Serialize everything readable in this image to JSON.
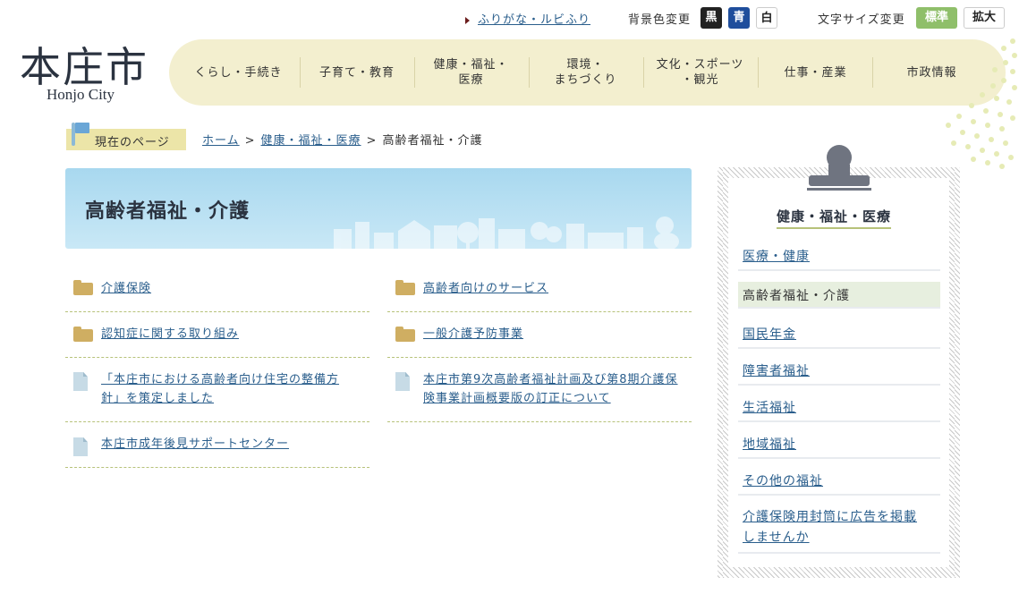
{
  "utility": {
    "furigana_link": "ふりがな・ルビふり",
    "bg_color_label": "背景色変更",
    "bg_black": "黒",
    "bg_blue": "青",
    "bg_white": "白",
    "font_size_label": "文字サイズ変更",
    "font_standard": "標準",
    "font_large": "拡大"
  },
  "logo": {
    "main": "本庄市",
    "sub": "Honjo City"
  },
  "nav": {
    "items": [
      {
        "label": "くらし・手続き"
      },
      {
        "label": "子育て・教育"
      },
      {
        "label1": "健康・福祉・",
        "label2": "医療"
      },
      {
        "label1": "環境・",
        "label2": "まちづくり"
      },
      {
        "label1": "文化・スポーツ",
        "label2": "・観光"
      },
      {
        "label": "仕事・産業"
      },
      {
        "label": "市政情報"
      }
    ]
  },
  "breadcrumb": {
    "current_label": "現在のページ",
    "home": "ホーム",
    "level1": "健康・福祉・医療",
    "current": "高齢者福祉・介護",
    "sep": ">"
  },
  "page": {
    "title": "高齢者福祉・介護"
  },
  "links": [
    {
      "icon": "folder-icon",
      "text": "介護保険"
    },
    {
      "icon": "folder-icon",
      "text": "高齢者向けのサービス"
    },
    {
      "icon": "folder-icon",
      "text": "認知症に関する取り組み"
    },
    {
      "icon": "folder-icon",
      "text": "一般介護予防事業"
    },
    {
      "icon": "document-icon",
      "text1": "「本庄市における高齢者向け住宅の整備方",
      "text2": "針」を策定しました"
    },
    {
      "icon": "document-icon",
      "text1": "本庄市第9次高齢者福祉計画及び第8期介護保",
      "text2": "険事業計画概要版の訂正について"
    },
    {
      "icon": "document-icon",
      "text": "本庄市成年後見サポートセンター"
    }
  ],
  "side": {
    "title": "健康・福祉・医療",
    "items": [
      "医療・健康",
      "高齢者福祉・介護",
      "国民年金",
      "障害者福祉",
      "生活福祉",
      "地域福祉",
      "その他の福祉"
    ],
    "last1": "介護保険用封筒に広告を掲載",
    "last2": "しませんか"
  },
  "colors": {
    "accent_green": "#8fbf6a",
    "nav_bg": "#f3efcf",
    "link": "#2a5e8c",
    "banner": "#a8d8ef"
  }
}
